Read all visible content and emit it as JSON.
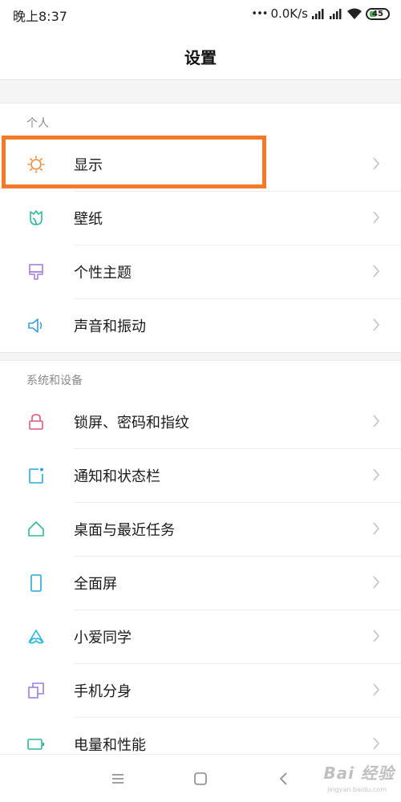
{
  "status_bar": {
    "time": "晚上8:37",
    "network_speed": "0.0K/s",
    "battery": "45",
    "icons": [
      "signal-icon",
      "signal-icon",
      "wifi-icon",
      "battery-icon"
    ]
  },
  "header": {
    "title": "设置"
  },
  "sections": [
    {
      "title": "个人",
      "items": [
        {
          "label": "显示",
          "icon": "brightness-icon",
          "color": "#f08a3c"
        },
        {
          "label": "壁纸",
          "icon": "tulip-icon",
          "color": "#2fb7a0"
        },
        {
          "label": "个性主题",
          "icon": "brush-icon",
          "color": "#a77fd8"
        },
        {
          "label": "声音和振动",
          "icon": "speaker-icon",
          "color": "#3a9de0"
        }
      ]
    },
    {
      "title": "系统和设备",
      "items": [
        {
          "label": "锁屏、密码和指纹",
          "icon": "lock-icon",
          "color": "#e0577a"
        },
        {
          "label": "通知和状态栏",
          "icon": "notification-icon",
          "color": "#2aa7d8"
        },
        {
          "label": "桌面与最近任务",
          "icon": "home-icon",
          "color": "#35b89a"
        },
        {
          "label": "全面屏",
          "icon": "phone-icon",
          "color": "#2aa7d8"
        },
        {
          "label": "小爱同学",
          "icon": "xiaoai-icon",
          "color": "#27b6e3"
        },
        {
          "label": "手机分身",
          "icon": "clone-icon",
          "color": "#9a7fe0"
        },
        {
          "label": "电量和性能",
          "icon": "battery-perf-icon",
          "color": "#2fb7a0"
        }
      ]
    }
  ],
  "nav": {
    "icons": [
      "menu-icon",
      "home-square-icon",
      "back-icon"
    ]
  },
  "watermark": {
    "text": "Bai 经验",
    "sub": "jingyan.baidu.com"
  },
  "colors": {
    "highlight": "#f47a2a",
    "chevron": "#c2c2c2"
  }
}
